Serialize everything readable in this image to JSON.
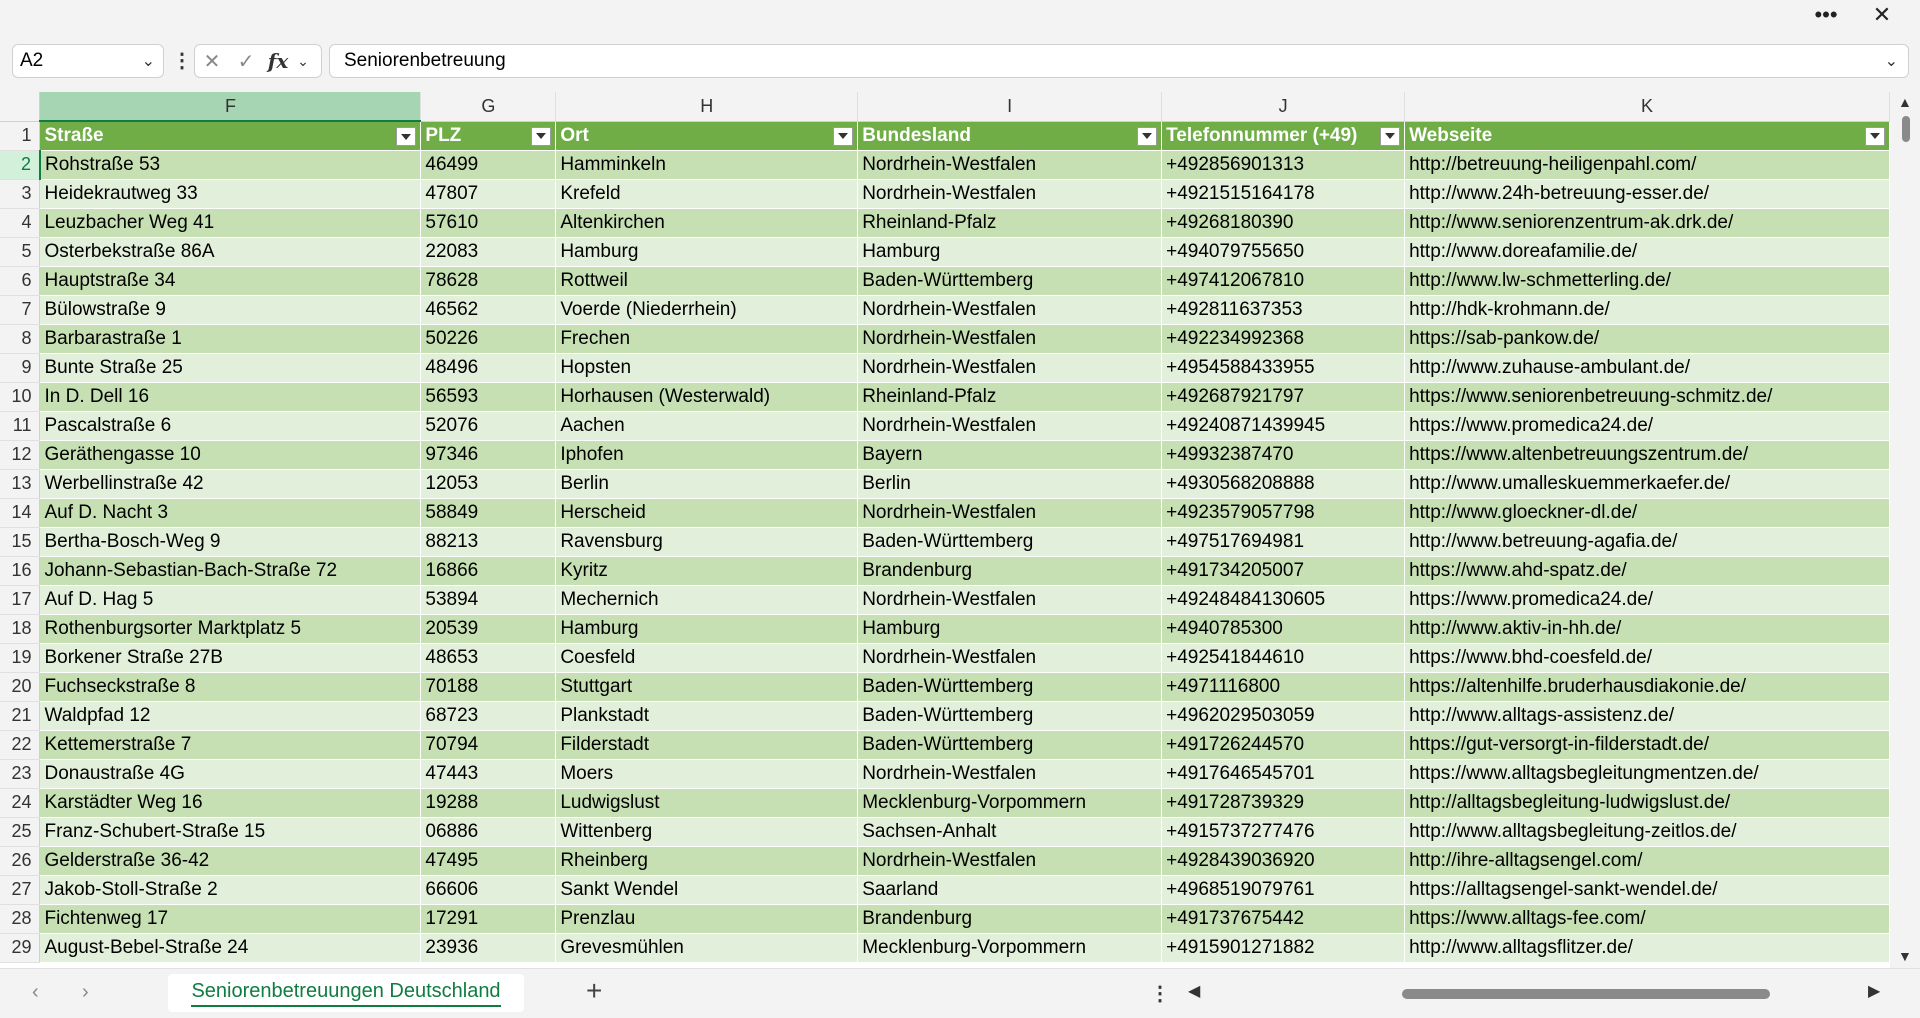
{
  "window": {
    "more_icon": "more-horizontal-icon",
    "close_icon": "close-icon",
    "more_glyph": "•••",
    "close_glyph": "✕"
  },
  "formula_bar": {
    "name_box": "A2",
    "formula": "Seniorenbetreuung",
    "fx": "fx",
    "cancel_glyph": "✕",
    "enter_glyph": "✓"
  },
  "sheet": {
    "selected_column": "F",
    "active_row": "2",
    "columns": [
      {
        "letter": "F",
        "header": "Straße"
      },
      {
        "letter": "G",
        "header": "PLZ"
      },
      {
        "letter": "H",
        "header": "Ort"
      },
      {
        "letter": "I",
        "header": "Bundesland"
      },
      {
        "letter": "J",
        "header": "Telefonnummer (+49)"
      },
      {
        "letter": "K",
        "header": "Webseite"
      }
    ],
    "header_row_number": "1",
    "rows": [
      {
        "n": "2",
        "cells": [
          "Rohstraße 53",
          "46499",
          "Hamminkeln",
          "Nordrhein-Westfalen",
          "+492856901313",
          "http://betreuung-heiligenpahl.com/"
        ]
      },
      {
        "n": "3",
        "cells": [
          "Heidekrautweg 33",
          "47807",
          "Krefeld",
          "Nordrhein-Westfalen",
          "+4921515164178",
          "http://www.24h-betreuung-esser.de/"
        ]
      },
      {
        "n": "4",
        "cells": [
          "Leuzbacher Weg 41",
          "57610",
          "Altenkirchen",
          "Rheinland-Pfalz",
          "+49268180390",
          "http://www.seniorenzentrum-ak.drk.de/"
        ]
      },
      {
        "n": "5",
        "cells": [
          "Osterbekstraße 86A",
          "22083",
          "Hamburg",
          "Hamburg",
          "+494079755650",
          "http://www.doreafamilie.de/"
        ]
      },
      {
        "n": "6",
        "cells": [
          "Hauptstraße 34",
          "78628",
          "Rottweil",
          "Baden-Württemberg",
          "+497412067810",
          "http://www.lw-schmetterling.de/"
        ]
      },
      {
        "n": "7",
        "cells": [
          "Bülowstraße 9",
          "46562",
          "Voerde (Niederrhein)",
          "Nordrhein-Westfalen",
          "+492811637353",
          "http://hdk-krohmann.de/"
        ]
      },
      {
        "n": "8",
        "cells": [
          "Barbarastraße 1",
          "50226",
          "Frechen",
          "Nordrhein-Westfalen",
          "+492234992368",
          "https://sab-pankow.de/"
        ]
      },
      {
        "n": "9",
        "cells": [
          "Bunte Straße 25",
          "48496",
          "Hopsten",
          "Nordrhein-Westfalen",
          "+4954588433955",
          "http://www.zuhause-ambulant.de/"
        ]
      },
      {
        "n": "10",
        "cells": [
          "In D. Dell 16",
          "56593",
          "Horhausen (Westerwald)",
          "Rheinland-Pfalz",
          "+492687921797",
          "https://www.seniorenbetreuung-schmitz.de/"
        ]
      },
      {
        "n": "11",
        "cells": [
          "Pascalstraße 6",
          "52076",
          "Aachen",
          "Nordrhein-Westfalen",
          "+49240871439945",
          "https://www.promedica24.de/"
        ]
      },
      {
        "n": "12",
        "cells": [
          "Geräthengasse 10",
          "97346",
          "Iphofen",
          "Bayern",
          "+49932387470",
          "https://www.altenbetreuungszentrum.de/"
        ]
      },
      {
        "n": "13",
        "cells": [
          "Werbellinstraße 42",
          "12053",
          "Berlin",
          "Berlin",
          "+4930568208888",
          "http://www.umalleskuemmerkaefer.de/"
        ]
      },
      {
        "n": "14",
        "cells": [
          "Auf D. Nacht 3",
          "58849",
          "Herscheid",
          "Nordrhein-Westfalen",
          "+4923579057798",
          "http://www.gloeckner-dl.de/"
        ]
      },
      {
        "n": "15",
        "cells": [
          "Bertha-Bosch-Weg 9",
          "88213",
          "Ravensburg",
          "Baden-Württemberg",
          "+497517694981",
          "http://www.betreuung-agafia.de/"
        ]
      },
      {
        "n": "16",
        "cells": [
          "Johann-Sebastian-Bach-Straße 72",
          "16866",
          "Kyritz",
          "Brandenburg",
          "+491734205007",
          "https://www.ahd-spatz.de/"
        ]
      },
      {
        "n": "17",
        "cells": [
          "Auf D. Hag 5",
          "53894",
          "Mechernich",
          "Nordrhein-Westfalen",
          "+49248484130605",
          "https://www.promedica24.de/"
        ]
      },
      {
        "n": "18",
        "cells": [
          "Rothenburgsorter Marktplatz 5",
          "20539",
          "Hamburg",
          "Hamburg",
          "+4940785300",
          "http://www.aktiv-in-hh.de/"
        ]
      },
      {
        "n": "19",
        "cells": [
          "Borkener Straße 27B",
          "48653",
          "Coesfeld",
          "Nordrhein-Westfalen",
          "+492541844610",
          "https://www.bhd-coesfeld.de/"
        ]
      },
      {
        "n": "20",
        "cells": [
          "Fuchseckstraße 8",
          "70188",
          "Stuttgart",
          "Baden-Württemberg",
          "+4971116800",
          "https://altenhilfe.bruderhausdiakonie.de/"
        ]
      },
      {
        "n": "21",
        "cells": [
          "Waldpfad 12",
          "68723",
          "Plankstadt",
          "Baden-Württemberg",
          "+4962029503059",
          "http://www.alltags-assistenz.de/"
        ]
      },
      {
        "n": "22",
        "cells": [
          "Kettemerstraße 7",
          "70794",
          "Filderstadt",
          "Baden-Württemberg",
          "+491726244570",
          "https://gut-versorgt-in-filderstadt.de/"
        ]
      },
      {
        "n": "23",
        "cells": [
          "Donaustraße 4G",
          "47443",
          "Moers",
          "Nordrhein-Westfalen",
          "+4917646545701",
          "https://www.alltagsbegleitungmentzen.de/"
        ]
      },
      {
        "n": "24",
        "cells": [
          "Karstädter Weg 16",
          "19288",
          "Ludwigslust",
          "Mecklenburg-Vorpommern",
          "+491728739329",
          "http://alltagsbegleitung-ludwigslust.de/"
        ]
      },
      {
        "n": "25",
        "cells": [
          "Franz-Schubert-Straße 15",
          "06886",
          "Wittenberg",
          "Sachsen-Anhalt",
          "+4915737277476",
          "http://www.alltagsbegleitung-zeitlos.de/"
        ]
      },
      {
        "n": "26",
        "cells": [
          "Gelderstraße 36-42",
          "47495",
          "Rheinberg",
          "Nordrhein-Westfalen",
          "+4928439036920",
          "http://ihre-alltagsengel.com/"
        ]
      },
      {
        "n": "27",
        "cells": [
          "Jakob-Stoll-Straße 2",
          "66606",
          "Sankt Wendel",
          "Saarland",
          "+4968519079761",
          "https://alltagsengel-sankt-wendel.de/"
        ]
      },
      {
        "n": "28",
        "cells": [
          "Fichtenweg 17",
          "17291",
          "Prenzlau",
          "Brandenburg",
          "+491737675442",
          "https://www.alltags-fee.com/"
        ]
      },
      {
        "n": "29",
        "cells": [
          "August-Bebel-Straße 24",
          "23936",
          "Grevesmühlen",
          "Mecklenburg-Vorpommern",
          "+4915901271882",
          "http://www.alltagsflitzer.de/"
        ]
      }
    ]
  },
  "tabs": {
    "sheet_name": "Seniorenbetreuungen Deutschland",
    "add_glyph": "+"
  },
  "colors": {
    "header_fill": "#70ad47",
    "band_dark": "#c6e0b4",
    "band_light": "#e2efda",
    "accent": "#107c41"
  }
}
